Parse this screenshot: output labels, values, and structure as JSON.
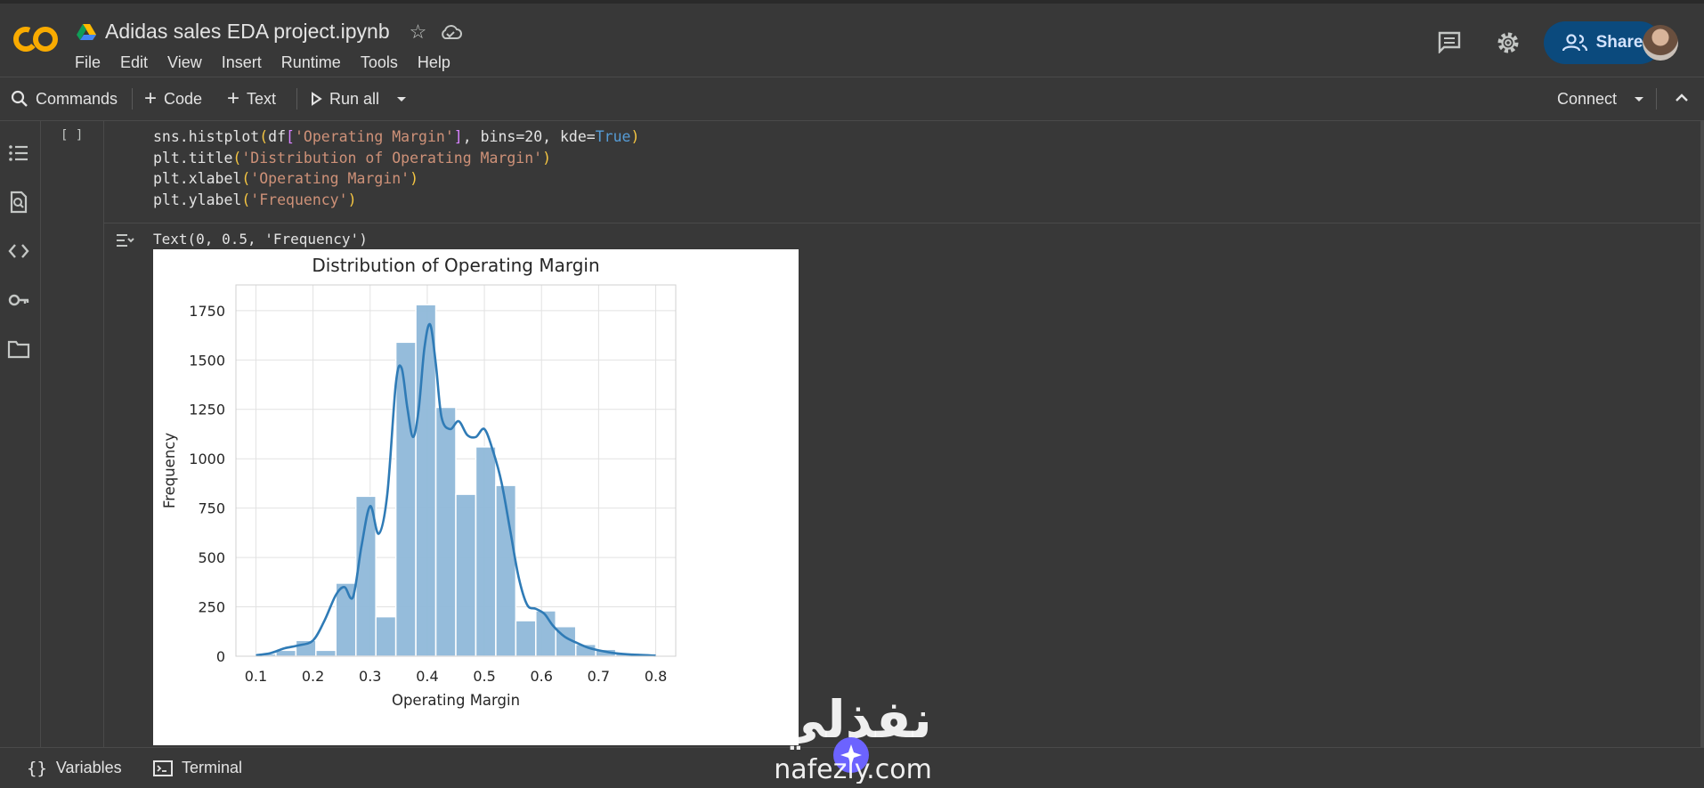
{
  "header": {
    "doc_title": "Adidas sales EDA project.ipynb",
    "menu": [
      "File",
      "Edit",
      "View",
      "Insert",
      "Runtime",
      "Tools",
      "Help"
    ],
    "share_label": "Share"
  },
  "toolbar": {
    "commands": "Commands",
    "code": "Code",
    "text": "Text",
    "run_all": "Run all",
    "connect": "Connect"
  },
  "cell": {
    "bracket": "[ ]",
    "output_text": "Text(0, 0.5, 'Frequency')"
  },
  "statusbar": {
    "variables": "Variables",
    "terminal": "Terminal"
  },
  "watermark": {
    "arabic": "نفذلي",
    "latin": "nafezly.com"
  },
  "colors": {
    "bar_fill": "#8fb8d9",
    "kde_line": "#2f7bb6",
    "share_bg": "#0b4a7d",
    "logo_orange": "#f9ab00"
  },
  "chart_data": {
    "type": "bar",
    "title": "Distribution of Operating Margin",
    "xlabel": "Operating Margin",
    "ylabel": "Frequency",
    "xlim": [
      0.065,
      0.835
    ],
    "ylim": [
      0,
      1880
    ],
    "xticks": [
      0.1,
      0.2,
      0.3,
      0.4,
      0.5,
      0.6,
      0.7,
      0.8
    ],
    "xtick_labels": [
      "0.1",
      "0.2",
      "0.3",
      "0.4",
      "0.5",
      "0.6",
      "0.7",
      "0.8"
    ],
    "yticks": [
      0,
      250,
      500,
      750,
      1000,
      1250,
      1500,
      1750
    ],
    "ytick_labels": [
      "0",
      "250",
      "500",
      "750",
      "1000",
      "1250",
      "1500",
      "1750"
    ],
    "grid": true,
    "bins": {
      "edges": [
        0.1,
        0.135,
        0.17,
        0.205,
        0.24,
        0.275,
        0.31,
        0.345,
        0.38,
        0.415,
        0.45,
        0.485,
        0.52,
        0.555,
        0.59,
        0.625,
        0.66,
        0.695,
        0.73,
        0.765,
        0.8
      ],
      "counts": [
        12,
        30,
        80,
        30,
        370,
        810,
        200,
        1590,
        1780,
        1260,
        820,
        1060,
        865,
        180,
        230,
        150,
        60,
        35,
        15,
        5
      ]
    },
    "kde": {
      "x": [
        0.1,
        0.125,
        0.15,
        0.175,
        0.2,
        0.22,
        0.24,
        0.255,
        0.27,
        0.285,
        0.3,
        0.315,
        0.33,
        0.345,
        0.355,
        0.365,
        0.375,
        0.385,
        0.395,
        0.405,
        0.415,
        0.425,
        0.44,
        0.455,
        0.47,
        0.485,
        0.5,
        0.515,
        0.53,
        0.545,
        0.56,
        0.575,
        0.59,
        0.605,
        0.62,
        0.64,
        0.66,
        0.68,
        0.7,
        0.73,
        0.76,
        0.8
      ],
      "y": [
        5,
        15,
        40,
        55,
        80,
        180,
        310,
        350,
        300,
        560,
        760,
        620,
        820,
        1380,
        1460,
        1260,
        1110,
        1250,
        1560,
        1680,
        1480,
        1210,
        1150,
        1190,
        1120,
        1110,
        1150,
        1040,
        880,
        640,
        400,
        260,
        240,
        215,
        155,
        100,
        70,
        45,
        30,
        15,
        8,
        3
      ]
    }
  }
}
